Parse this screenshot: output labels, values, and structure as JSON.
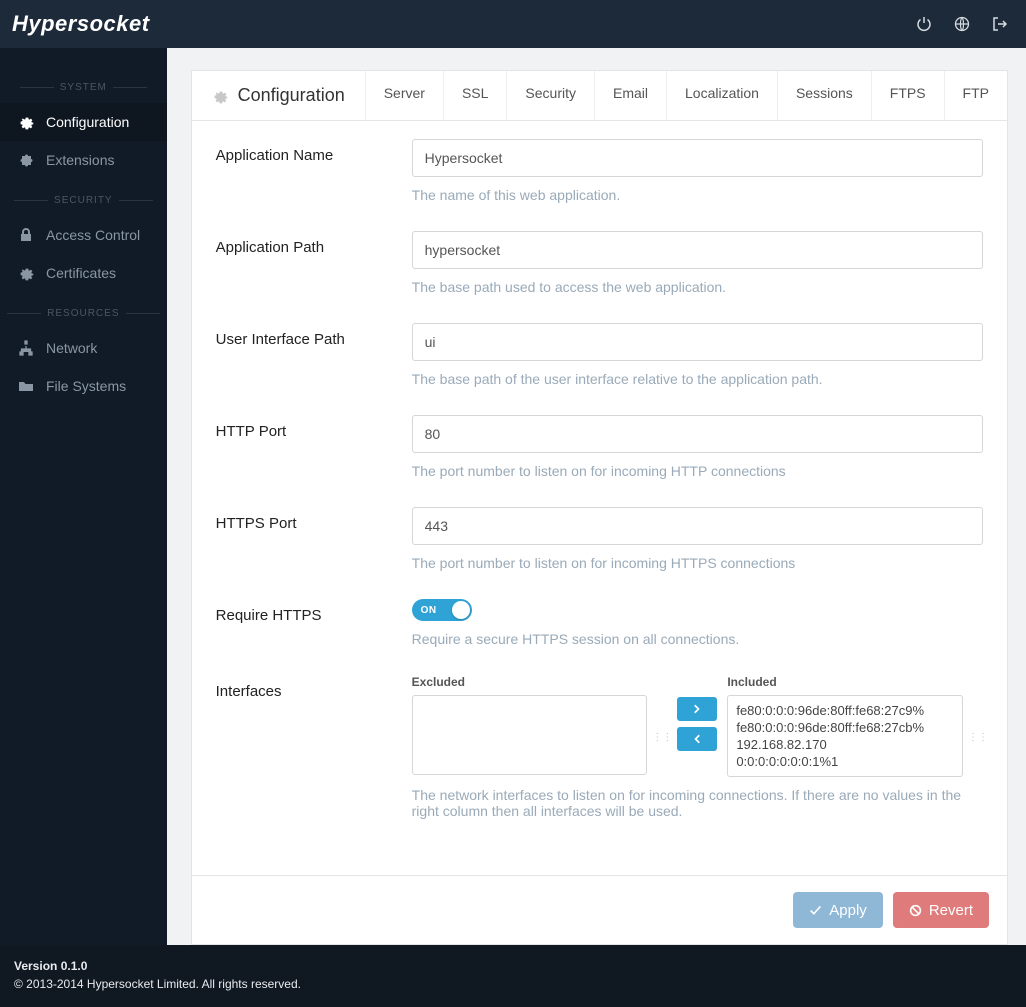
{
  "brand": "Hypersocket",
  "sidebar": {
    "sections": [
      {
        "heading": "SYSTEM",
        "items": [
          {
            "icon": "gear",
            "label": "Configuration",
            "active": true
          },
          {
            "icon": "puzzle",
            "label": "Extensions",
            "active": false
          }
        ]
      },
      {
        "heading": "SECURITY",
        "items": [
          {
            "icon": "lock",
            "label": "Access Control",
            "active": false
          },
          {
            "icon": "gear",
            "label": "Certificates",
            "active": false
          }
        ]
      },
      {
        "heading": "RESOURCES",
        "items": [
          {
            "icon": "sitemap",
            "label": "Network",
            "active": false
          },
          {
            "icon": "folder",
            "label": "File Systems",
            "active": false
          }
        ]
      }
    ]
  },
  "panel": {
    "title": "Configuration",
    "tabs": [
      "Server",
      "SSL",
      "Security",
      "Email",
      "Localization",
      "Sessions",
      "FTPS",
      "FTP"
    ]
  },
  "form": {
    "appName": {
      "label": "Application Name",
      "value": "Hypersocket",
      "help": "The name of this web application."
    },
    "appPath": {
      "label": "Application Path",
      "value": "hypersocket",
      "help": "The base path used to access the web application."
    },
    "uiPath": {
      "label": "User Interface Path",
      "value": "ui",
      "help": "The base path of the user interface relative to the application path."
    },
    "httpPort": {
      "label": "HTTP Port",
      "value": "80",
      "help": "The port number to listen on for incoming HTTP connections"
    },
    "httpsPort": {
      "label": "HTTPS Port",
      "value": "443",
      "help": "The port number to listen on for incoming HTTPS connections"
    },
    "requireHttps": {
      "label": "Require HTTPS",
      "state": "ON",
      "help": "Require a secure HTTPS session on all connections."
    },
    "interfaces": {
      "label": "Interfaces",
      "excludedLabel": "Excluded",
      "includedLabel": "Included",
      "excluded": [],
      "included": [
        "fe80:0:0:0:96de:80ff:fe68:27c9%",
        "fe80:0:0:0:96de:80ff:fe68:27cb%",
        "192.168.82.170",
        "0:0:0:0:0:0:0:1%1"
      ],
      "help": "The network interfaces to listen on for incoming connections. If there are no values in the right column then all interfaces will be used."
    }
  },
  "actions": {
    "apply": "Apply",
    "revert": "Revert"
  },
  "footer": {
    "version": "Version 0.1.0",
    "copyright": "© 2013-2014 Hypersocket Limited. All rights reserved."
  }
}
